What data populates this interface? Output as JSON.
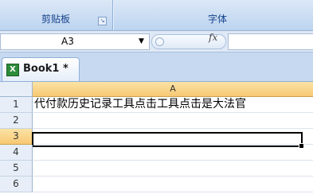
{
  "ribbon": {
    "groups": [
      {
        "label": "剪贴板"
      },
      {
        "label": "字体"
      }
    ]
  },
  "formula_bar": {
    "name_box": "A3",
    "fx_label": "fx",
    "formula": ""
  },
  "workbook": {
    "tab_label": "Book1 *",
    "icon": "excel-icon"
  },
  "sheet": {
    "column_headers": [
      "A"
    ],
    "active_cell": "A3",
    "rows": [
      {
        "number": "1",
        "A": "代付款历史记录工具点击工具点击是大法官"
      },
      {
        "number": "2",
        "A": ""
      },
      {
        "number": "3",
        "A": ""
      },
      {
        "number": "4",
        "A": ""
      },
      {
        "number": "5",
        "A": ""
      },
      {
        "number": "6",
        "A": ""
      }
    ]
  },
  "colors": {
    "selected_header": "#f7c873",
    "ribbon_text": "#15428b"
  }
}
